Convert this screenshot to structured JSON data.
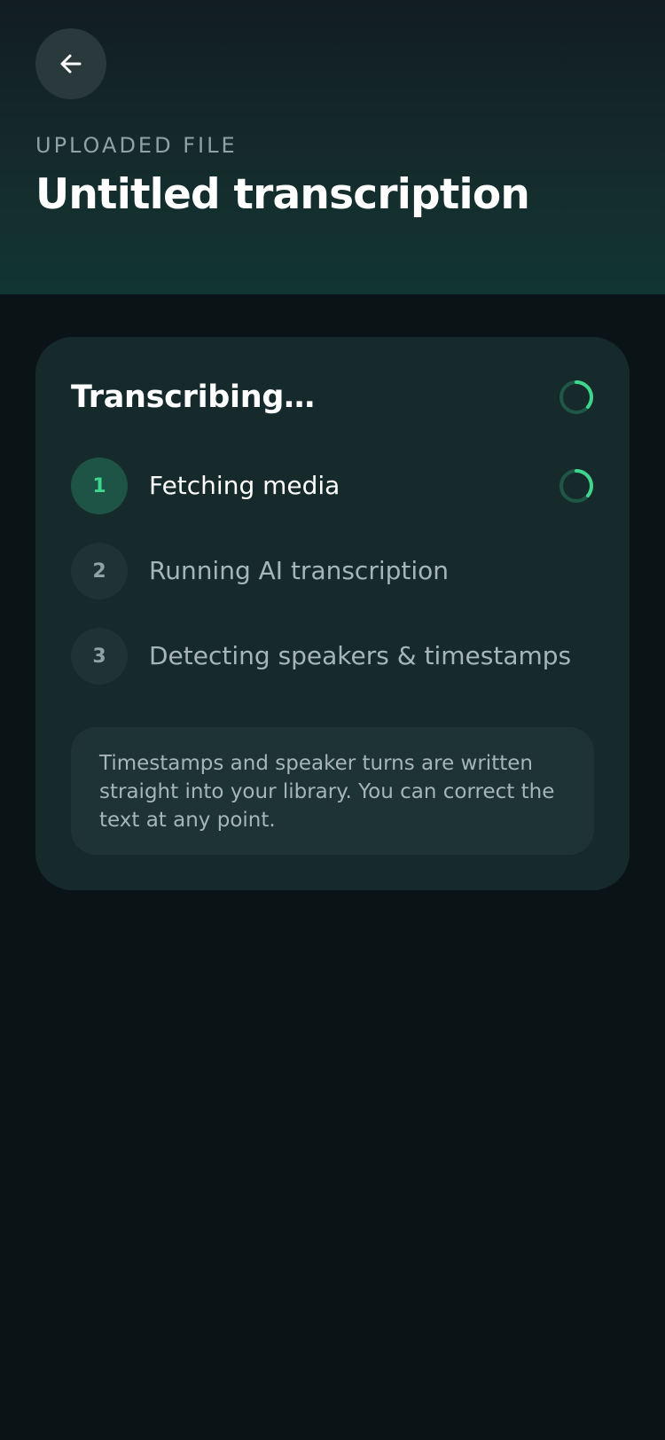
{
  "header": {
    "back_icon": "arrow-left-icon",
    "eyebrow": "UPLOADED FILE",
    "title": "Untitled transcription"
  },
  "status_card": {
    "title": "Transcribing…",
    "steps": [
      {
        "number": "1",
        "label": "Fetching media",
        "state": "in-progress"
      },
      {
        "number": "2",
        "label": "Running AI transcription",
        "state": "pending"
      },
      {
        "number": "3",
        "label": "Detecting speakers & timestamps",
        "state": "pending"
      }
    ],
    "note": "Timestamps and speaker turns are written straight into your library. You can correct the text at any point."
  },
  "colors": {
    "accent": "#3dd68c",
    "background": "#0a1416",
    "card": "#172a2b",
    "spinner_track": "#1f5747"
  }
}
